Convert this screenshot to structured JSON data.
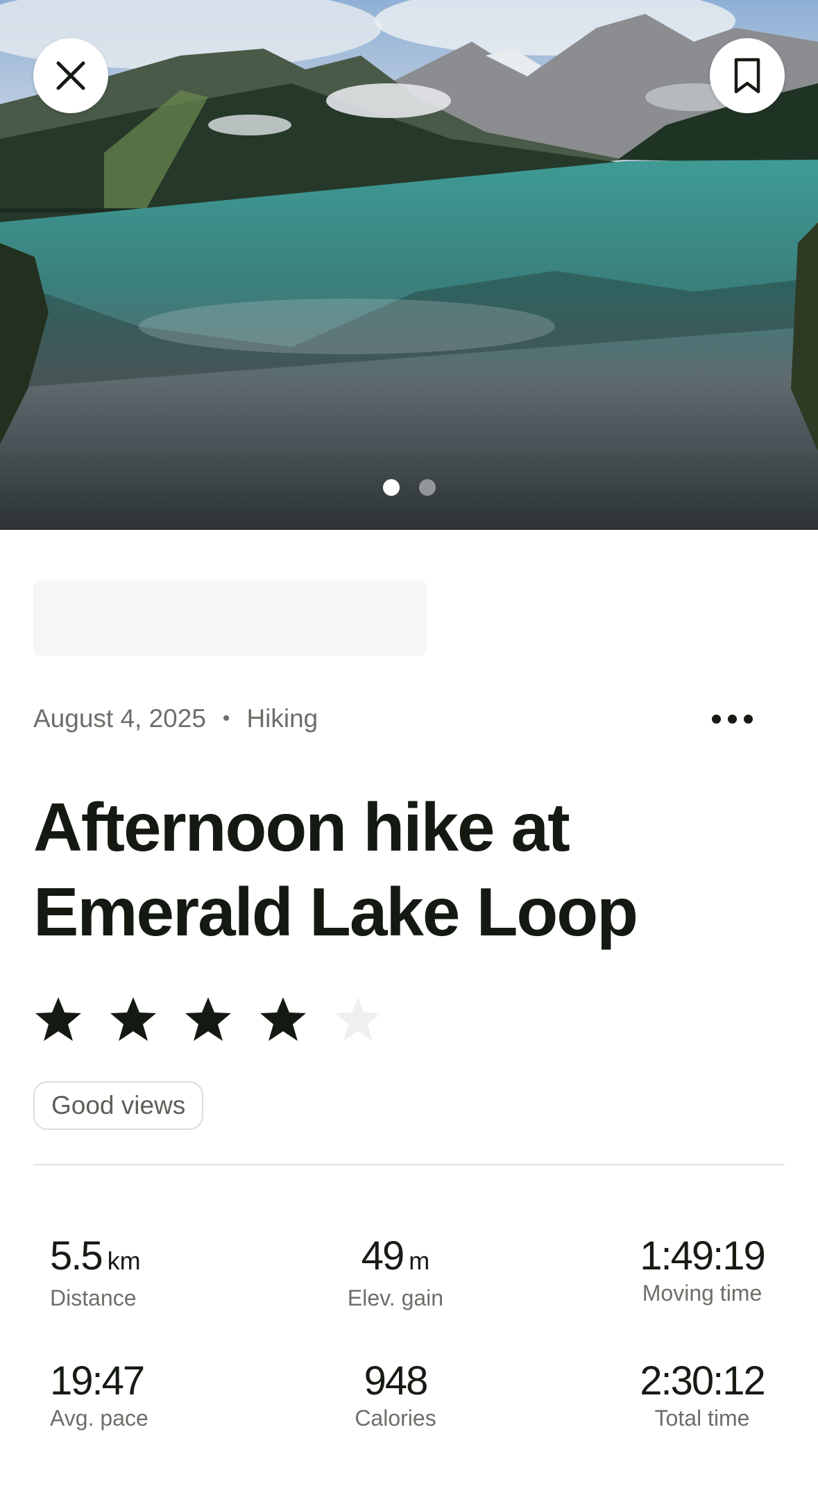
{
  "hero": {
    "close_icon": "close-icon",
    "bookmark_icon": "bookmark-icon",
    "carousel": {
      "count": 2,
      "active": 0
    }
  },
  "activity": {
    "date": "August 4, 2025",
    "separator": "•",
    "type": "Hiking",
    "more_icon": "more-horizontal-icon",
    "title": "Afternoon hike at Emerald Lake Loop",
    "rating": 4,
    "rating_max": 5,
    "tag": "Good views"
  },
  "stats": [
    {
      "value": "5.5",
      "unit": "km",
      "label": "Distance"
    },
    {
      "value": "49",
      "unit": "m",
      "label": "Elev. gain"
    },
    {
      "value": "1:49:19",
      "unit": "",
      "label": "Moving time"
    },
    {
      "value": "19:47",
      "unit": "",
      "label": "Avg. pace"
    },
    {
      "value": "948",
      "unit": "",
      "label": "Calories"
    },
    {
      "value": "2:30:12",
      "unit": "",
      "label": "Total time"
    }
  ],
  "colors": {
    "text": "#161b14",
    "muted": "#6b6f68",
    "star_filled": "#141a12",
    "star_empty": "#eef0ee"
  }
}
